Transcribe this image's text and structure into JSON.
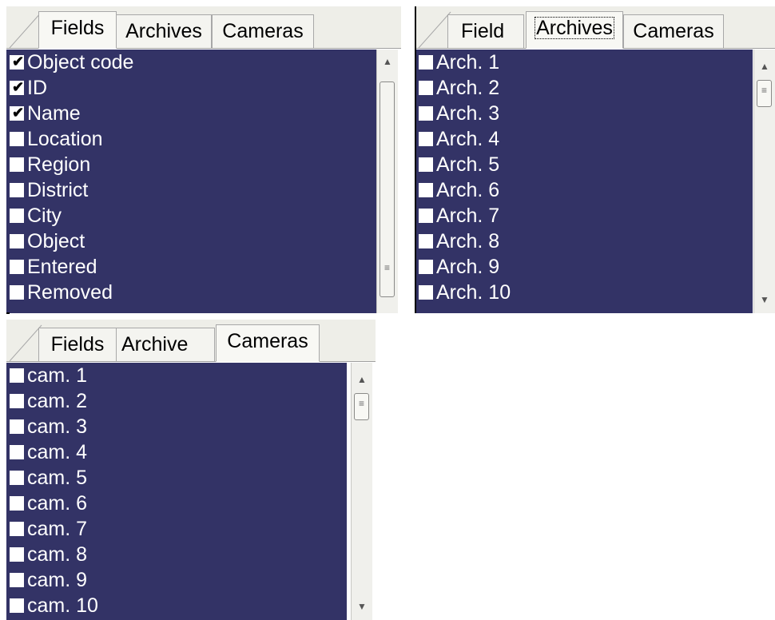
{
  "tabs": [
    "Fields",
    "Archives",
    "Cameras"
  ],
  "panels": {
    "fields": {
      "tabs": [
        "Fields",
        "Archives",
        "Cameras"
      ],
      "items": [
        {
          "label": "Object code",
          "checked": true
        },
        {
          "label": "ID",
          "checked": true
        },
        {
          "label": "Name",
          "checked": true
        },
        {
          "label": "Location",
          "checked": false
        },
        {
          "label": "Region",
          "checked": false
        },
        {
          "label": "District",
          "checked": false
        },
        {
          "label": "City",
          "checked": false
        },
        {
          "label": "Object",
          "checked": false
        },
        {
          "label": "Entered",
          "checked": false
        },
        {
          "label": "Removed",
          "checked": false
        }
      ]
    },
    "archives": {
      "tabs": [
        "Field",
        "Archives",
        "Cameras"
      ],
      "items": [
        {
          "label": "Arch. 1",
          "checked": false
        },
        {
          "label": "Arch. 2",
          "checked": false
        },
        {
          "label": "Arch. 3",
          "checked": false
        },
        {
          "label": "Arch. 4",
          "checked": false
        },
        {
          "label": "Arch. 5",
          "checked": false
        },
        {
          "label": "Arch. 6",
          "checked": false
        },
        {
          "label": "Arch. 7",
          "checked": false
        },
        {
          "label": "Arch. 8",
          "checked": false
        },
        {
          "label": "Arch. 9",
          "checked": false
        },
        {
          "label": "Arch. 10",
          "checked": false
        }
      ]
    },
    "cameras": {
      "tabs": [
        "Fields",
        "Archive",
        "Cameras"
      ],
      "items": [
        {
          "label": "cam. 1",
          "checked": false
        },
        {
          "label": "cam. 2",
          "checked": false
        },
        {
          "label": "cam. 3",
          "checked": false
        },
        {
          "label": "cam. 4",
          "checked": false
        },
        {
          "label": "cam. 5",
          "checked": false
        },
        {
          "label": "cam. 6",
          "checked": false
        },
        {
          "label": "cam. 7",
          "checked": false
        },
        {
          "label": "cam. 8",
          "checked": false
        },
        {
          "label": "cam. 9",
          "checked": false
        },
        {
          "label": "cam. 10",
          "checked": false
        }
      ]
    }
  },
  "icons": {
    "scroll_up": "▲",
    "scroll_down": "▼",
    "thumb_grip": "≡",
    "check": "✔"
  },
  "colors": {
    "list_bg": "#333366",
    "list_text": "#ffffff",
    "checkbox_bg": "#ffffff"
  }
}
